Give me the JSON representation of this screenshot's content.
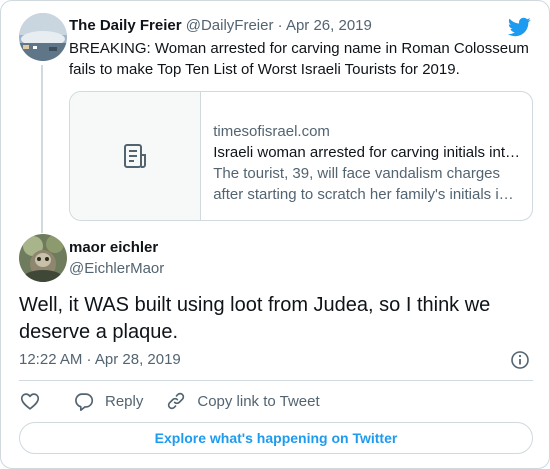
{
  "brand_color": "#1d9bf0",
  "parent_tweet": {
    "author_name": "The Daily Freier",
    "author_meta": "@DailyFreier · Apr 26, 2019",
    "text": "BREAKING: Woman arrested for carving name in Roman Colosseum fails to make Top Ten List of Worst Israeli Tourists for 2019.",
    "link_card": {
      "domain": "timesofisrael.com",
      "title": "Israeli woman arrested for carving initials int…",
      "description_line1": "The tourist, 39, will face vandalism charges",
      "description_line2": "after starting to scratch her family's initials i…",
      "thumb_icon": "article-icon"
    }
  },
  "main_tweet": {
    "author_name": "maor eichler",
    "author_handle": "@EichlerMaor",
    "text": "Well, it WAS built using loot from Judea, so I think we deserve a plaque.",
    "timestamp": "12:22 AM · Apr 28, 2019"
  },
  "actions": {
    "reply_label": "Reply",
    "copy_label": "Copy link to Tweet"
  },
  "explore_label": "Explore what's happening on Twitter"
}
